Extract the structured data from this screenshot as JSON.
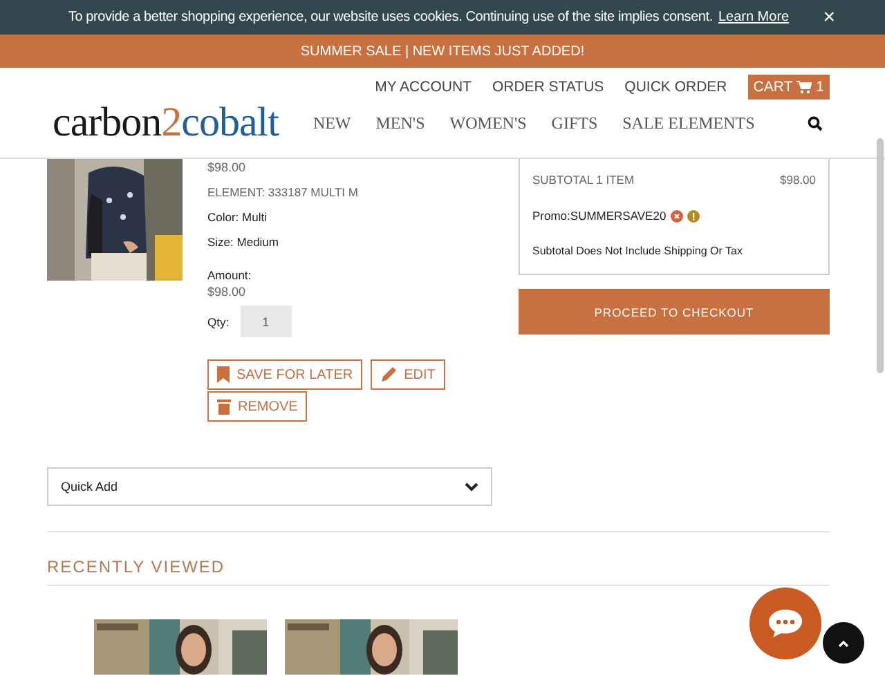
{
  "cookie_bar": {
    "message": "To provide a better shopping experience, our website uses cookies. Continuing use of the site implies consent.",
    "link": "Learn More",
    "close": "×"
  },
  "promo_bar": {
    "text": "SUMMER SALE | NEW ITEMS JUST ADDED!"
  },
  "header": {
    "utility_links": [
      "MY ACCOUNT",
      "ORDER STATUS",
      "QUICK ORDER"
    ],
    "cart": {
      "label": "CART",
      "count": "1"
    },
    "logo": {
      "part1": "carbon",
      "part2": "2",
      "part3": "cobalt"
    },
    "nav": [
      "NEW",
      "MEN'S",
      "WOMEN'S",
      "GIFTS",
      "SALE ELEMENTS"
    ]
  },
  "cart_item": {
    "price": "$98.00",
    "element": "ELEMENT: 333187 MULTI M",
    "color_label": "Color: Multi",
    "size_label": "Size: Medium",
    "amount_label": "Amount:",
    "amount": "$98.00",
    "qty_label": "Qty:",
    "qty": "1",
    "actions": [
      {
        "kind": "save",
        "label": "SAVE FOR LATER"
      },
      {
        "kind": "edit",
        "label": "EDIT"
      },
      {
        "kind": "remove",
        "label": "REMOVE"
      }
    ]
  },
  "summary": {
    "subtotal_label": "SUBTOTAL 1 ITEM",
    "subtotal": "$98.00",
    "promo": "Promo:SUMMERSAVE20",
    "note": "Subtotal Does Not Include Shipping Or Tax",
    "checkout": "PROCEED TO CHECKOUT"
  },
  "quick_add": {
    "value": "Quick Add"
  },
  "recently_viewed": {
    "title": "RECENTLY VIEWED"
  }
}
